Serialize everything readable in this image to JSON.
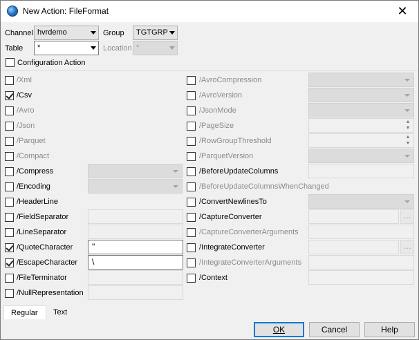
{
  "window": {
    "title": "New Action: FileFormat",
    "close_glyph": "✕"
  },
  "top": {
    "channel_label": "Channel",
    "channel_value": "hvrdemo",
    "group_label": "Group",
    "group_value": "TGTGRP",
    "table_label": "Table",
    "table_value": "*",
    "location_label": "Location",
    "location_value": "*",
    "config_action_label": "Configuration Action"
  },
  "left_params": [
    {
      "label": "/Xml",
      "checked": false,
      "enabled": false,
      "control": "none",
      "value": ""
    },
    {
      "label": "/Csv",
      "checked": true,
      "enabled": true,
      "control": "none",
      "value": ""
    },
    {
      "label": "/Avro",
      "checked": false,
      "enabled": false,
      "control": "none",
      "value": ""
    },
    {
      "label": "/Json",
      "checked": false,
      "enabled": false,
      "control": "none",
      "value": ""
    },
    {
      "label": "/Parquet",
      "checked": false,
      "enabled": false,
      "control": "none",
      "value": ""
    },
    {
      "label": "/Compact",
      "checked": false,
      "enabled": false,
      "control": "none",
      "value": ""
    },
    {
      "label": "/Compress",
      "checked": false,
      "enabled": true,
      "control": "dropdown",
      "value": ""
    },
    {
      "label": "/Encoding",
      "checked": false,
      "enabled": true,
      "control": "dropdown",
      "value": ""
    },
    {
      "label": "/HeaderLine",
      "checked": false,
      "enabled": true,
      "control": "none",
      "value": ""
    },
    {
      "label": "/FieldSeparator",
      "checked": false,
      "enabled": true,
      "control": "text",
      "value": ""
    },
    {
      "label": "/LineSeparator",
      "checked": false,
      "enabled": true,
      "control": "text",
      "value": ""
    },
    {
      "label": "/QuoteCharacter",
      "checked": true,
      "enabled": true,
      "control": "text-active",
      "value": "\""
    },
    {
      "label": "/EscapeCharacter",
      "checked": true,
      "enabled": true,
      "control": "text-active",
      "value": "\\"
    },
    {
      "label": "/FileTerminator",
      "checked": false,
      "enabled": true,
      "control": "text",
      "value": ""
    },
    {
      "label": "/NullRepresentation",
      "checked": false,
      "enabled": true,
      "control": "text",
      "value": ""
    }
  ],
  "right_params": [
    {
      "label": "/AvroCompression",
      "checked": false,
      "enabled": false,
      "control": "dropdown"
    },
    {
      "label": "/AvroVersion",
      "checked": false,
      "enabled": false,
      "control": "dropdown"
    },
    {
      "label": "/JsonMode",
      "checked": false,
      "enabled": false,
      "control": "dropdown"
    },
    {
      "label": "/PageSize",
      "checked": false,
      "enabled": false,
      "control": "spin"
    },
    {
      "label": "/RowGroupThreshold",
      "checked": false,
      "enabled": false,
      "control": "spin"
    },
    {
      "label": "/ParquetVersion",
      "checked": false,
      "enabled": false,
      "control": "dropdown"
    },
    {
      "label": "/BeforeUpdateColumns",
      "checked": false,
      "enabled": true,
      "control": "text"
    },
    {
      "label": "/BeforeUpdateColumnsWhenChanged",
      "checked": false,
      "enabled": false,
      "control": "none"
    },
    {
      "label": "/ConvertNewlinesTo",
      "checked": false,
      "enabled": true,
      "control": "dropdown"
    },
    {
      "label": "/CaptureConverter",
      "checked": false,
      "enabled": true,
      "control": "text-ellipsis"
    },
    {
      "label": "/CaptureConverterArguments",
      "checked": false,
      "enabled": false,
      "control": "text"
    },
    {
      "label": "/IntegrateConverter",
      "checked": false,
      "enabled": true,
      "control": "text-ellipsis"
    },
    {
      "label": "/IntegrateConverterArguments",
      "checked": false,
      "enabled": false,
      "control": "text"
    },
    {
      "label": "/Context",
      "checked": false,
      "enabled": true,
      "control": "text"
    }
  ],
  "tabs": [
    {
      "label": "Regular",
      "active": true
    },
    {
      "label": "Text",
      "active": false
    }
  ],
  "buttons": {
    "ok": "OK",
    "cancel": "Cancel",
    "help": "Help"
  },
  "ellipsis_glyph": "…",
  "spin_up": "▲",
  "spin_down": "▼",
  "colors": {
    "accent": "#0078d7",
    "disabled_text": "#8a8a8a",
    "window_bg": "#f0f0f0"
  }
}
